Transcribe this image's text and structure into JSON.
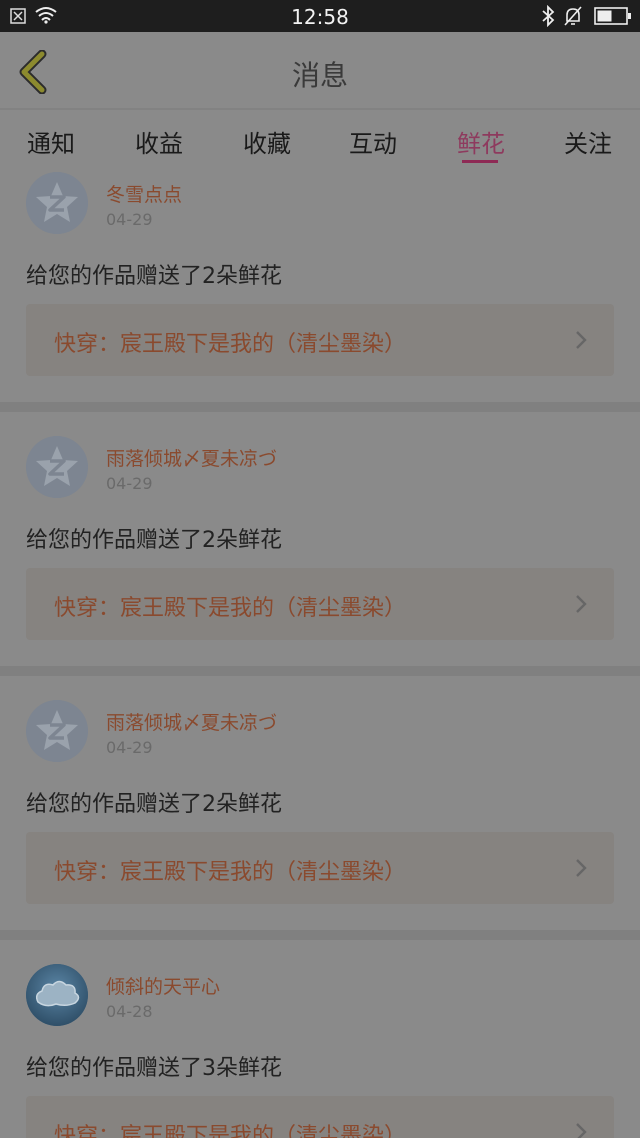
{
  "status_bar": {
    "time": "12:58",
    "icons": [
      "notification-icon",
      "wifi-icon",
      "bluetooth-icon",
      "mute-icon",
      "battery-icon"
    ]
  },
  "header": {
    "title": "消息",
    "back_icon": "chevron-left-icon"
  },
  "tabs": [
    {
      "label": "通知",
      "active": false
    },
    {
      "label": "收益",
      "active": false
    },
    {
      "label": "收藏",
      "active": false
    },
    {
      "label": "互动",
      "active": false
    },
    {
      "label": "鲜花",
      "active": true
    },
    {
      "label": "关注",
      "active": false
    }
  ],
  "messages": [
    {
      "user": "冬雪点点",
      "date": "04-29",
      "text": "给您的作品赠送了2朵鲜花",
      "work": "快穿：宸王殿下是我的（清尘墨染）",
      "avatar": "default-avatar-icon"
    },
    {
      "user": "雨落倾城〆夏未凉づ",
      "date": "04-29",
      "text": "给您的作品赠送了2朵鲜花",
      "work": "快穿：宸王殿下是我的（清尘墨染）",
      "avatar": "default-avatar-icon"
    },
    {
      "user": "雨落倾城〆夏未凉づ",
      "date": "04-29",
      "text": "给您的作品赠送了2朵鲜花",
      "work": "快穿：宸王殿下是我的（清尘墨染）",
      "avatar": "default-avatar-icon"
    },
    {
      "user": "倾斜的天平心",
      "date": "04-28",
      "text": "给您的作品赠送了3朵鲜花",
      "work": "快穿：宸王殿下是我的（清尘墨染）",
      "avatar": "cloud-avatar-icon"
    }
  ],
  "colors": {
    "accent": "#8e2a55",
    "username": "#8a4a2e",
    "overlay_dim": "#808080"
  }
}
